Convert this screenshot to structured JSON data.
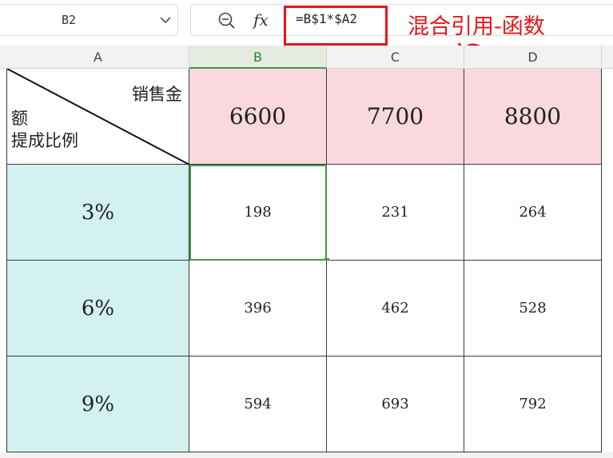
{
  "name_box": {
    "value": "B2"
  },
  "formula_bar": {
    "formula": "=B$1*$A2",
    "fx_label": "fx"
  },
  "annotation": {
    "text": "混合引用-函数",
    "color": "#e8141c"
  },
  "columns": [
    {
      "label": "A",
      "active": false
    },
    {
      "label": "B",
      "active": true
    },
    {
      "label": "C",
      "active": false
    },
    {
      "label": "D",
      "active": false
    }
  ],
  "corner_cell": {
    "top_label": "销售金",
    "mid_label": "额",
    "bottom_label": "提成比例"
  },
  "header_row": [
    "6600",
    "7700",
    "8800"
  ],
  "rows": [
    {
      "rate": "3%",
      "values": [
        "198",
        "231",
        "264"
      ]
    },
    {
      "rate": "6%",
      "values": [
        "396",
        "462",
        "528"
      ]
    },
    {
      "rate": "9%",
      "values": [
        "594",
        "693",
        "792"
      ]
    }
  ],
  "selected_cell": "B2",
  "colors": {
    "header_fill": "#f9d9de",
    "rate_fill": "#d3f1f1",
    "selection": "#3f9a43"
  }
}
